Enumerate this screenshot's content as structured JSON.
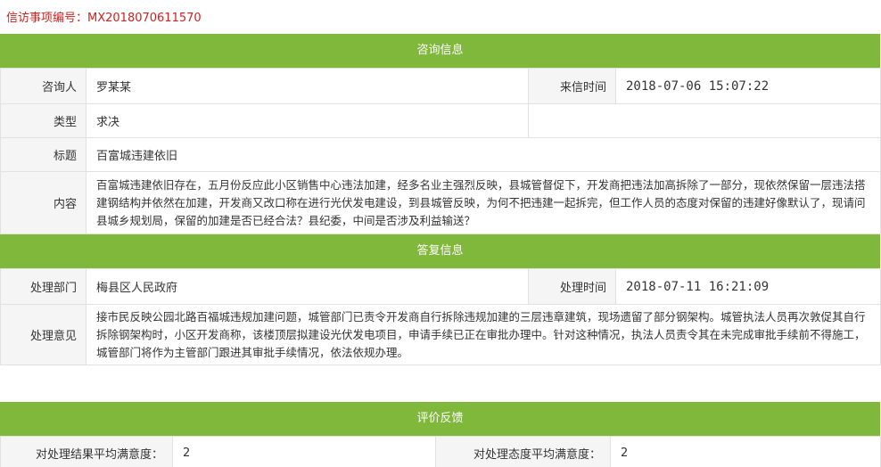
{
  "header": {
    "case_label": "信访事项编号：",
    "case_number": "MX2018070611570"
  },
  "consult": {
    "section_title": "咨询信息",
    "consultant_label": "咨询人",
    "consultant_value": "罗某某",
    "received_time_label": "来信时间",
    "received_time_value": "2018-07-06 15:07:22",
    "type_label": "类型",
    "type_value": "求决",
    "title_label": "标题",
    "title_value": "百富城违建依旧",
    "content_label": "内容",
    "content_value": "百富城违建依旧存在，五月份反应此小区销售中心违法加建，经多名业主强烈反映，县城管督促下，开发商把违法加高拆除了一部分，现依然保留一层违法搭建钢结构并依然在加建，开发商又改口称在进行光伏发电建设，到县城管反映，为何不把违建一起拆完，但工作人员的态度对保留的违建好像默认了，现请问县城乡规划局，保留的加建是否已经合法？县纪委，中间是否涉及利益输送？"
  },
  "reply": {
    "section_title": "答复信息",
    "dept_label": "处理部门",
    "dept_value": "梅县区人民政府",
    "handle_time_label": "处理时间",
    "handle_time_value": "2018-07-11 16:21:09",
    "opinion_label": "处理意见",
    "opinion_value": "接市民反映公园北路百福城违规加建问题，城管部门已责令开发商自行拆除违规加建的三层违章建筑，现场遗留了部分钢架构。城管执法人员再次敦促其自行拆除钢架构时，小区开发商称，该楼顶层拟建设光伏发电项目，申请手续已正在审批办理中。针对这种情况，执法人员责令其在未完成审批手续前不得施工，城管部门将作为主管部门跟进其审批手续情况，依法依规办理。"
  },
  "feedback": {
    "section_title": "评价反馈",
    "result_label": "对处理结果平均满意度：",
    "result_value": "2",
    "attitude_label": "对处理态度平均满意度：",
    "attitude_value": "2"
  },
  "colors": {
    "section_green": "#80b83b",
    "case_red": "#cc2222",
    "label_bg": "#f5f5f5",
    "border": "#e2e2e2"
  }
}
